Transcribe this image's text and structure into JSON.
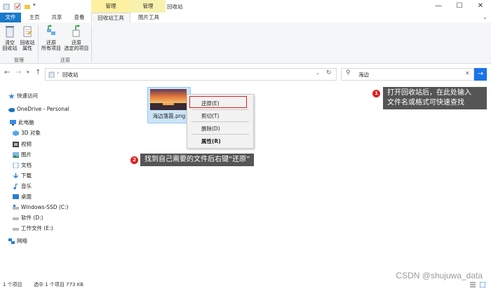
{
  "titlebar": {
    "context_tab_1": "管理",
    "context_tab_2": "管理",
    "window_title": "回收站",
    "minimize": "—",
    "maximize": "☐",
    "close": "✕",
    "ctx1_color": "#fdf0a0",
    "ctx2_color": "#f7f1b0"
  },
  "ribbon_tabs": [
    "文件",
    "主页",
    "共享",
    "查看",
    "回收站工具",
    "图片工具"
  ],
  "ribbon": {
    "buttons": [
      {
        "label": "清空\n回收站",
        "line1": "清空",
        "line2": "回收站"
      },
      {
        "label": "回收站属性",
        "line1": "回收站",
        "line2": "属性"
      },
      {
        "label": "还原所有项目",
        "line1": "还原",
        "line2": "所有项目"
      },
      {
        "label": "还原选定的项目",
        "line1": "还原",
        "line2": "选定的项目"
      }
    ],
    "group_manage": "管理",
    "group_restore": "还原"
  },
  "address": {
    "path": "回收站",
    "search_value": "海边"
  },
  "nav": {
    "quick_access": "快速访问",
    "onedrive": "OneDrive - Personal",
    "this_pc": "此电脑",
    "objects_3d": "3D 对象",
    "video": "视频",
    "pictures": "图片",
    "documents": "文档",
    "downloads": "下载",
    "music": "音乐",
    "desktop": "桌面",
    "drive_c": "Windows-SSD (C:)",
    "drive_d": "软件 (D:)",
    "drive_e": "工作文件 (E:)",
    "network": "网络"
  },
  "file": {
    "name": "海边落霞.png"
  },
  "context_menu": {
    "restore": "还原(E)",
    "cut": "剪切(T)",
    "delete": "删除(D)",
    "properties": "属性(R)"
  },
  "callouts": {
    "one_num": "1",
    "one_line1": "打开回收站后，在此处输入",
    "one_line2": "文件名或格式可快速查找",
    "two_num": "2",
    "two_text": "找到自己需要的文件后右键“还原”"
  },
  "status": {
    "count": "1 个项目",
    "selected": "选中 1 个项目  773 KB"
  },
  "watermark": "CSDN @shujuwa_data"
}
